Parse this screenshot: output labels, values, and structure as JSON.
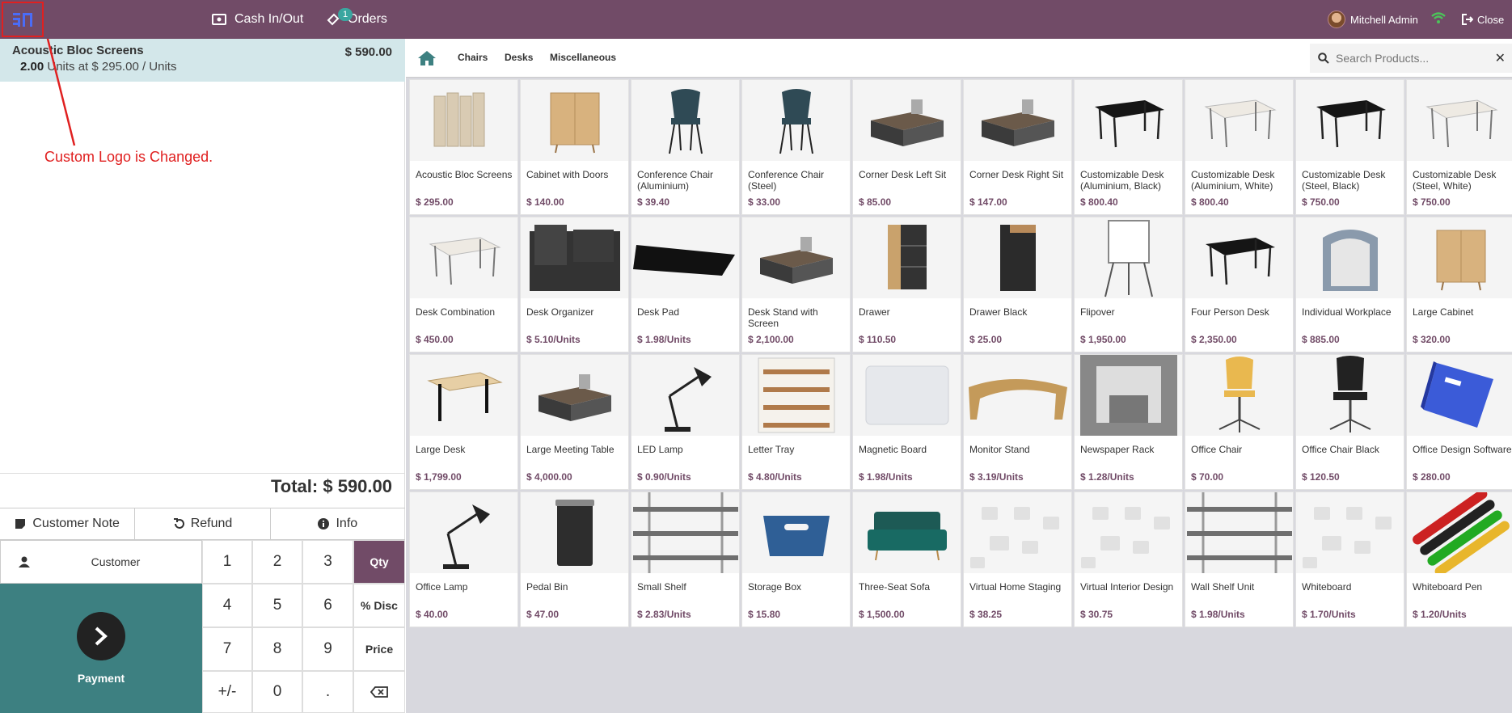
{
  "topbar": {
    "cash_label": "Cash In/Out",
    "orders_label": "Orders",
    "orders_badge": "1",
    "user_name": "Mitchell Admin",
    "close_label": "Close",
    "brand_color": "#714B67"
  },
  "order": {
    "line": {
      "name": "Acoustic Bloc Screens",
      "price": "$ 590.00",
      "qty": "2.00",
      "unit_text": "Units at $ 295.00 / Units"
    },
    "total_label": "Total:",
    "total_value": "$ 590.00"
  },
  "annotation": {
    "text": "Custom Logo is Changed."
  },
  "controls": {
    "customer_note": "Customer Note",
    "refund": "Refund",
    "info": "Info",
    "customer": "Customer",
    "payment": "Payment"
  },
  "numpad": {
    "k1": "1",
    "k2": "2",
    "k3": "3",
    "qty": "Qty",
    "k4": "4",
    "k5": "5",
    "k6": "6",
    "disc": "% Disc",
    "k7": "7",
    "k8": "8",
    "k9": "9",
    "price": "Price",
    "sign": "+/-",
    "k0": "0",
    "dot": "."
  },
  "categories": [
    "Chairs",
    "Desks",
    "Miscellaneous"
  ],
  "search": {
    "placeholder": "Search Products..."
  },
  "products": [
    {
      "name": "Acoustic Bloc Screens",
      "price": "$ 295.00",
      "icon": "screen"
    },
    {
      "name": "Cabinet with Doors",
      "price": "$ 140.00",
      "icon": "cabinet"
    },
    {
      "name": "Conference Chair (Aluminium)",
      "price": "$ 39.40",
      "icon": "chair"
    },
    {
      "name": "Conference Chair (Steel)",
      "price": "$ 33.00",
      "icon": "chair"
    },
    {
      "name": "Corner Desk Left Sit",
      "price": "$ 85.00",
      "icon": "desk"
    },
    {
      "name": "Corner Desk Right Sit",
      "price": "$ 147.00",
      "icon": "desk"
    },
    {
      "name": "Customizable Desk (Aluminium, Black)",
      "price": "$ 800.40",
      "icon": "table-black"
    },
    {
      "name": "Customizable Desk (Aluminium, White)",
      "price": "$ 800.40",
      "icon": "table-white"
    },
    {
      "name": "Customizable Desk (Steel, Black)",
      "price": "$ 750.00",
      "icon": "table-black"
    },
    {
      "name": "Customizable Desk (Steel, White)",
      "price": "$ 750.00",
      "icon": "table-white"
    },
    {
      "name": "Desk Combination",
      "price": "$ 450.00",
      "icon": "table-white"
    },
    {
      "name": "Desk Organizer",
      "price": "$ 5.10/Units",
      "icon": "organizer"
    },
    {
      "name": "Desk Pad",
      "price": "$ 1.98/Units",
      "icon": "pad"
    },
    {
      "name": "Desk Stand with Screen",
      "price": "$ 2,100.00",
      "icon": "desk"
    },
    {
      "name": "Drawer",
      "price": "$ 110.50",
      "icon": "drawer"
    },
    {
      "name": "Drawer Black",
      "price": "$ 25.00",
      "icon": "drawer-black"
    },
    {
      "name": "Flipover",
      "price": "$ 1,950.00",
      "icon": "flipover"
    },
    {
      "name": "Four Person Desk",
      "price": "$ 2,350.00",
      "icon": "table-black"
    },
    {
      "name": "Individual Workplace",
      "price": "$ 885.00",
      "icon": "pod"
    },
    {
      "name": "Large Cabinet",
      "price": "$ 320.00",
      "icon": "cabinet"
    },
    {
      "name": "Large Desk",
      "price": "$ 1,799.00",
      "icon": "table-wood"
    },
    {
      "name": "Large Meeting Table",
      "price": "$ 4,000.00",
      "icon": "desk"
    },
    {
      "name": "LED Lamp",
      "price": "$ 0.90/Units",
      "icon": "lamp"
    },
    {
      "name": "Letter Tray",
      "price": "$ 4.80/Units",
      "icon": "tray"
    },
    {
      "name": "Magnetic Board",
      "price": "$ 1.98/Units",
      "icon": "board"
    },
    {
      "name": "Monitor Stand",
      "price": "$ 3.19/Units",
      "icon": "stand"
    },
    {
      "name": "Newspaper Rack",
      "price": "$ 1.28/Units",
      "icon": "rack"
    },
    {
      "name": "Office Chair",
      "price": "$ 70.00",
      "icon": "office-chair"
    },
    {
      "name": "Office Chair Black",
      "price": "$ 120.50",
      "icon": "office-chair-black"
    },
    {
      "name": "Office Design Software",
      "price": "$ 280.00",
      "icon": "box"
    },
    {
      "name": "Office Lamp",
      "price": "$ 40.00",
      "icon": "lamp"
    },
    {
      "name": "Pedal Bin",
      "price": "$ 47.00",
      "icon": "bin"
    },
    {
      "name": "Small Shelf",
      "price": "$ 2.83/Units",
      "icon": "shelf"
    },
    {
      "name": "Storage Box",
      "price": "$ 15.80",
      "icon": "storage"
    },
    {
      "name": "Three-Seat Sofa",
      "price": "$ 1,500.00",
      "icon": "sofa"
    },
    {
      "name": "Virtual Home Staging",
      "price": "$ 38.25",
      "icon": "placeholder"
    },
    {
      "name": "Virtual Interior Design",
      "price": "$ 30.75",
      "icon": "placeholder"
    },
    {
      "name": "Wall Shelf Unit",
      "price": "$ 1.98/Units",
      "icon": "shelf"
    },
    {
      "name": "Whiteboard",
      "price": "$ 1.70/Units",
      "icon": "placeholder"
    },
    {
      "name": "Whiteboard Pen",
      "price": "$ 1.20/Units",
      "icon": "pens"
    }
  ]
}
